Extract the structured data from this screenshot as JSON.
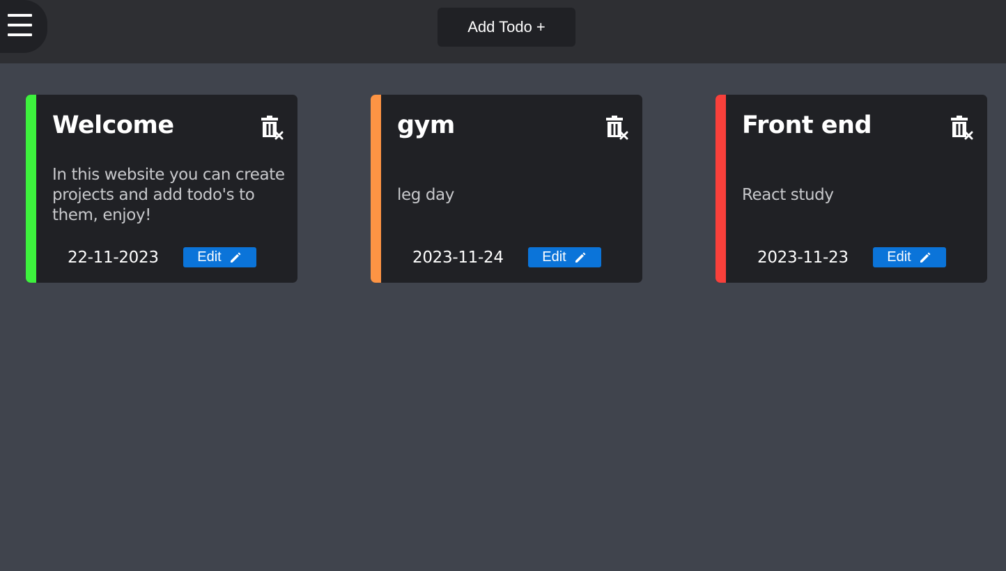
{
  "header": {
    "menu_icon": "hamburger-menu-icon",
    "add_todo_label": "Add Todo +"
  },
  "colors": {
    "background": "#40444d",
    "topbar": "#2e2f33",
    "card": "#202125",
    "edit_button": "#0b74d9"
  },
  "todos": [
    {
      "title": "Welcome",
      "description": "In this website you can create projects and add todo's to them, enjoy!",
      "date": "22-11-2023",
      "edit_label": "Edit",
      "priority_color": "#3df23d",
      "delete_icon": "trash-remove-icon",
      "edit_icon": "pencil-icon"
    },
    {
      "title": "gym",
      "description": "leg day",
      "date": "2023-11-24",
      "edit_label": "Edit",
      "priority_color": "#fd9444",
      "delete_icon": "trash-remove-icon",
      "edit_icon": "pencil-icon"
    },
    {
      "title": "Front end",
      "description": "React study",
      "date": "2023-11-23",
      "edit_label": "Edit",
      "priority_color": "#f9403b",
      "delete_icon": "trash-remove-icon",
      "edit_icon": "pencil-icon"
    }
  ]
}
